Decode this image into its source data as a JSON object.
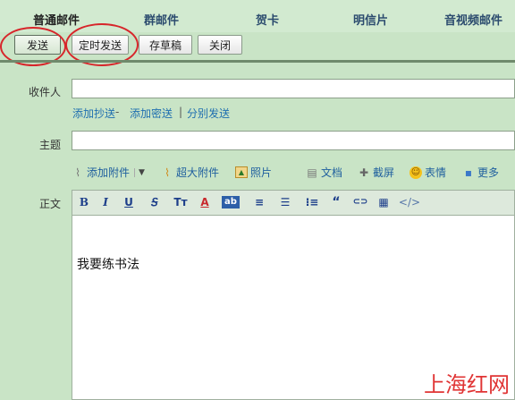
{
  "tabs": [
    "普通邮件",
    "群邮件",
    "贺卡",
    "明信片",
    "音视频邮件"
  ],
  "actions": {
    "send": "发送",
    "scheduled_send": "定时发送",
    "save_draft": "存草稿",
    "close": "关闭"
  },
  "form": {
    "recipient_label": "收件人",
    "recipient_value": "",
    "add_cc": "添加抄送",
    "dash": " - ",
    "add_bcc": "添加密送",
    "pipe": "|",
    "separate_send": "分别发送",
    "subject_label": "主题",
    "subject_value": "",
    "body_label": "正文"
  },
  "attach_tools": {
    "add_attachment": "添加附件",
    "large_attachment": "超大附件",
    "photo": "照片",
    "document": "文档",
    "screenshot": "截屏",
    "emoji": "表情",
    "more": "更多"
  },
  "editor_toolbar": [
    "B",
    "I",
    "U",
    "Ꭶ",
    "Tт",
    "A",
    "ab",
    "≡",
    "☰",
    "⁝≡",
    "“",
    "⊂⊃",
    "▦",
    "</>"
  ],
  "editor": {
    "body_text": "我要练书法"
  },
  "watermark": "上海红网",
  "icons": {
    "paperclip": "paperclip-icon",
    "large-attach": "large-attachment-icon",
    "photo": "photo-icon",
    "document": "document-icon",
    "screenshot": "screenshot-icon",
    "emoji": "emoji-icon",
    "more": "more-icon"
  },
  "colors": {
    "background": "#c9e4c6",
    "link": "#1f6fb0",
    "annotation_circle": "#d7262b",
    "watermark": "#e03434"
  }
}
